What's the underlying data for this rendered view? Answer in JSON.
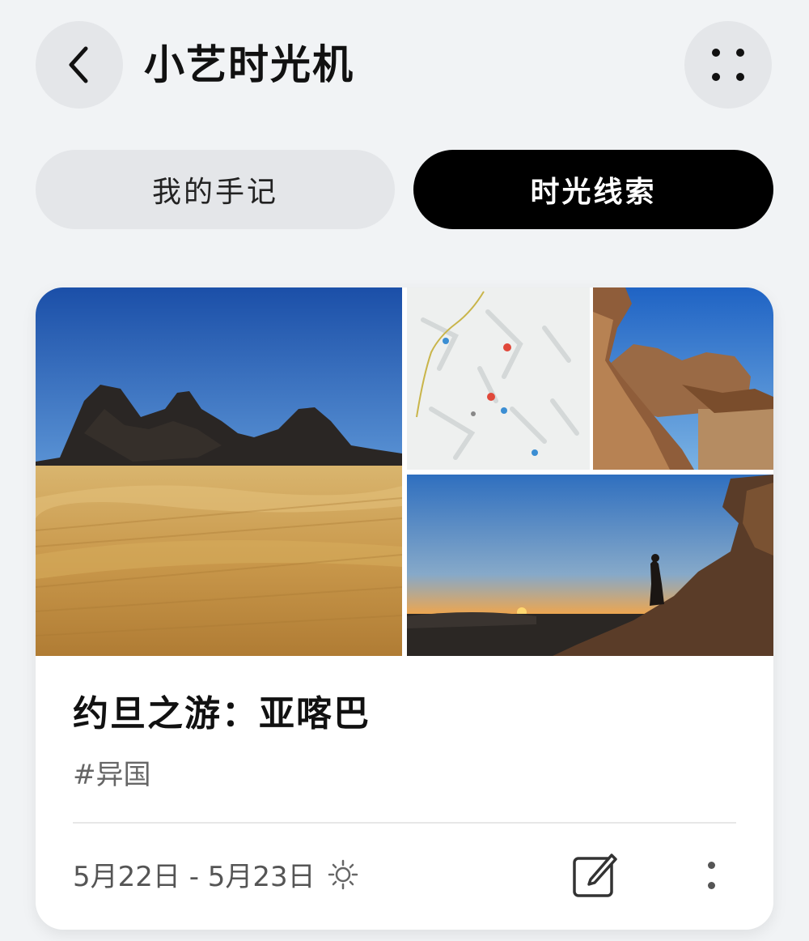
{
  "header": {
    "title": "小艺时光机",
    "back_icon": "chevron-left-icon",
    "more_icon": "grid-dots-icon"
  },
  "tabs": [
    {
      "label": "我的手记",
      "active": false
    },
    {
      "label": "时光线索",
      "active": true
    }
  ],
  "card": {
    "title": "约旦之游：亚喀巴",
    "tag": "#异国",
    "date_range": "5月22日 - 5月23日",
    "weather_icon": "sun-icon",
    "edit_icon": "edit-note-icon",
    "menu_icon": "more-vertical-icon",
    "photos": [
      "desert-dunes",
      "map",
      "rock-arch",
      "sunset-silhouette"
    ]
  },
  "colors": {
    "background": "#f1f3f5",
    "active_tab": "#000000",
    "inactive_tab": "#e4e6e9"
  }
}
